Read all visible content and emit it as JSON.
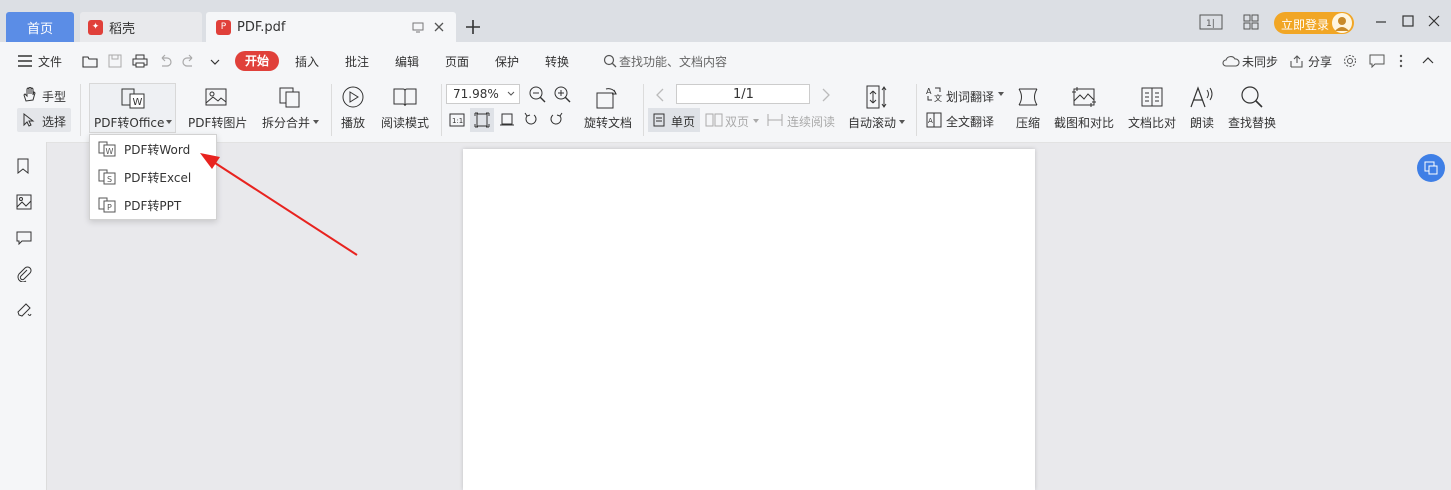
{
  "tabs": {
    "home": "首页",
    "daoke": "稻壳",
    "pdf": "PDF.pdf"
  },
  "titlebar": {
    "login": "立即登录"
  },
  "menu": {
    "file": "文件",
    "start": "开始",
    "insert": "插入",
    "annotate": "批注",
    "edit": "编辑",
    "page": "页面",
    "protect": "保护",
    "convert": "转换",
    "search_placeholder": "查找功能、文档内容",
    "sync": "未同步",
    "share": "分享"
  },
  "ribbon": {
    "hand": "手型",
    "select": "选择",
    "pdf_to_office": "PDF转Office",
    "pdf_to_image": "PDF转图片",
    "split_merge": "拆分合并",
    "play": "播放",
    "read_mode": "阅读模式",
    "zoom": "71.98%",
    "rotate_doc": "旋转文档",
    "page_indicator": "1/1",
    "single_page": "单页",
    "double_page": "双页",
    "continuous": "连续阅读",
    "auto_scroll": "自动滚动",
    "word_translate": "划词翻译",
    "full_translate": "全文翻译",
    "compress": "压缩",
    "screenshot_compare": "截图和对比",
    "doc_compare": "文档比对",
    "read_aloud": "朗读",
    "find_replace": "查找替换"
  },
  "dropdown": {
    "items": [
      "PDF转Word",
      "PDF转Excel",
      "PDF转PPT"
    ]
  },
  "colors": {
    "accent_red": "#e0403a",
    "home_tab": "#5b8de6",
    "login_orange": "#f1a625",
    "arrow_red": "#e8231f"
  }
}
